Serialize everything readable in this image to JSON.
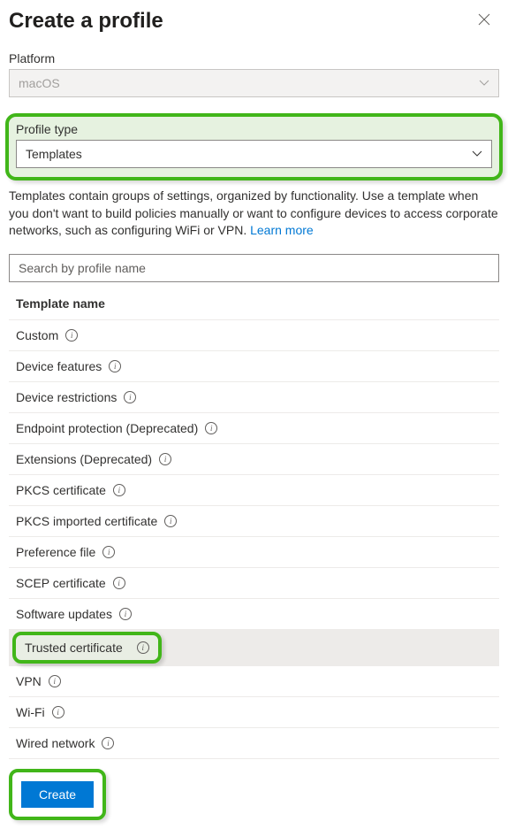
{
  "header": {
    "title": "Create a profile"
  },
  "platform": {
    "label": "Platform",
    "value": "macOS"
  },
  "profileType": {
    "label": "Profile type",
    "value": "Templates"
  },
  "description": {
    "text": "Templates contain groups of settings, organized by functionality. Use a template when you don't want to build policies manually or want to configure devices to access corporate networks, such as configuring WiFi or VPN. ",
    "linkText": "Learn more"
  },
  "search": {
    "placeholder": "Search by profile name"
  },
  "table": {
    "header": "Template name"
  },
  "templates": [
    {
      "name": "Custom"
    },
    {
      "name": "Device features"
    },
    {
      "name": "Device restrictions"
    },
    {
      "name": "Endpoint protection (Deprecated)"
    },
    {
      "name": "Extensions (Deprecated)"
    },
    {
      "name": "PKCS certificate"
    },
    {
      "name": "PKCS imported certificate"
    },
    {
      "name": "Preference file"
    },
    {
      "name": "SCEP certificate"
    },
    {
      "name": "Software updates"
    },
    {
      "name": "Trusted certificate"
    },
    {
      "name": "VPN"
    },
    {
      "name": "Wi-Fi"
    },
    {
      "name": "Wired network"
    }
  ],
  "selectedTemplate": "Trusted certificate",
  "footer": {
    "createLabel": "Create"
  }
}
